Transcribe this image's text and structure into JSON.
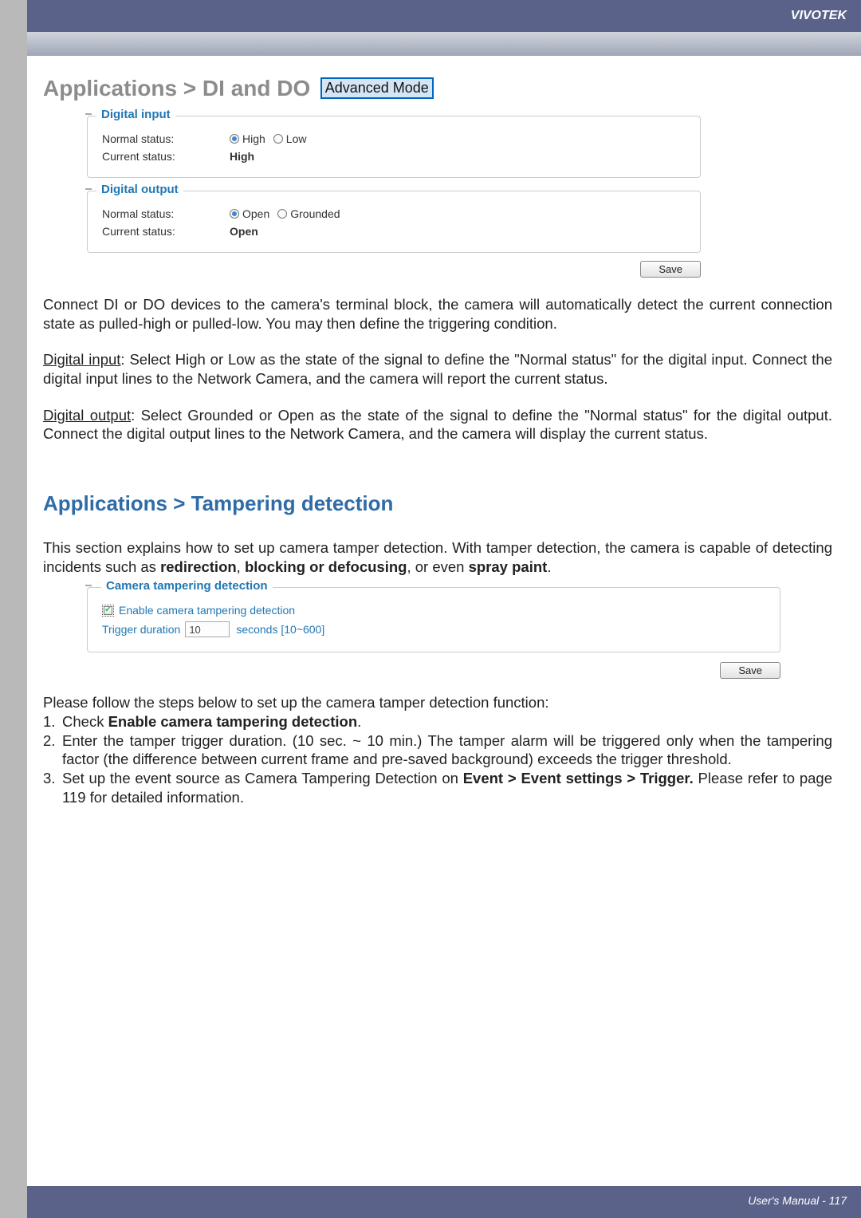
{
  "brand": "VIVOTEK",
  "section1": {
    "title": "Applications > DI and DO",
    "badge": "Advanced Mode",
    "digital_input": {
      "legend": "Digital input",
      "normal_label": "Normal status:",
      "opt_high": "High",
      "opt_low": "Low",
      "current_label": "Current status:",
      "current_value": "High"
    },
    "digital_output": {
      "legend": "Digital output",
      "normal_label": "Normal status:",
      "opt_open": "Open",
      "opt_grounded": "Grounded",
      "current_label": "Current status:",
      "current_value": "Open"
    },
    "save": "Save",
    "para_connect": "Connect DI or DO devices to the camera's terminal block, the camera will automatically detect the current connection state as pulled-high or pulled-low. You may then define the triggering condition.",
    "para_di_head": "Digital input",
    "para_di_body": ": Select High or Low as the state of the signal to define the \"Normal status\" for the digital input. Connect the digital input lines to the Network Camera, and the camera will report the current status.",
    "para_do_head": "Digital output",
    "para_do_body": ": Select Grounded or Open as the state of the signal to define the \"Normal status\" for the digital output. Connect the digital output lines to the Network Camera, and the camera will display the current status."
  },
  "section2": {
    "title": "Applications > Tampering detection",
    "intro_a": "This section explains how to set up camera tamper detection. With tamper detection, the camera is capable of detecting incidents such as ",
    "intro_b": "redirection",
    "intro_c": ", ",
    "intro_d": "blocking or defocusing",
    "intro_e": ", or even ",
    "intro_f": "spray paint",
    "intro_g": ".",
    "tampering": {
      "legend": "Camera tampering detection",
      "cb_label": "Enable camera tampering detection",
      "trigger_label": "Trigger duration",
      "trigger_value": "10",
      "trigger_units": "seconds [10~600]"
    },
    "save": "Save",
    "steps_intro": "Please follow the steps below to set up the camera tamper detection function:",
    "step1_a": "Check ",
    "step1_b": "Enable camera tampering detection",
    "step1_c": ".",
    "step2": "Enter the tamper trigger duration. (10 sec. ~ 10 min.) The tamper alarm will be triggered only when the tampering factor (the difference between current frame and pre-saved background) exceeds the trigger threshold.",
    "step3_a": "Set up the event source as Camera Tampering Detection on ",
    "step3_b": "Event > Event settings > Trigger.",
    "step3_c": " Please refer to page 119 for detailed information."
  },
  "footer": "User's Manual - 117"
}
